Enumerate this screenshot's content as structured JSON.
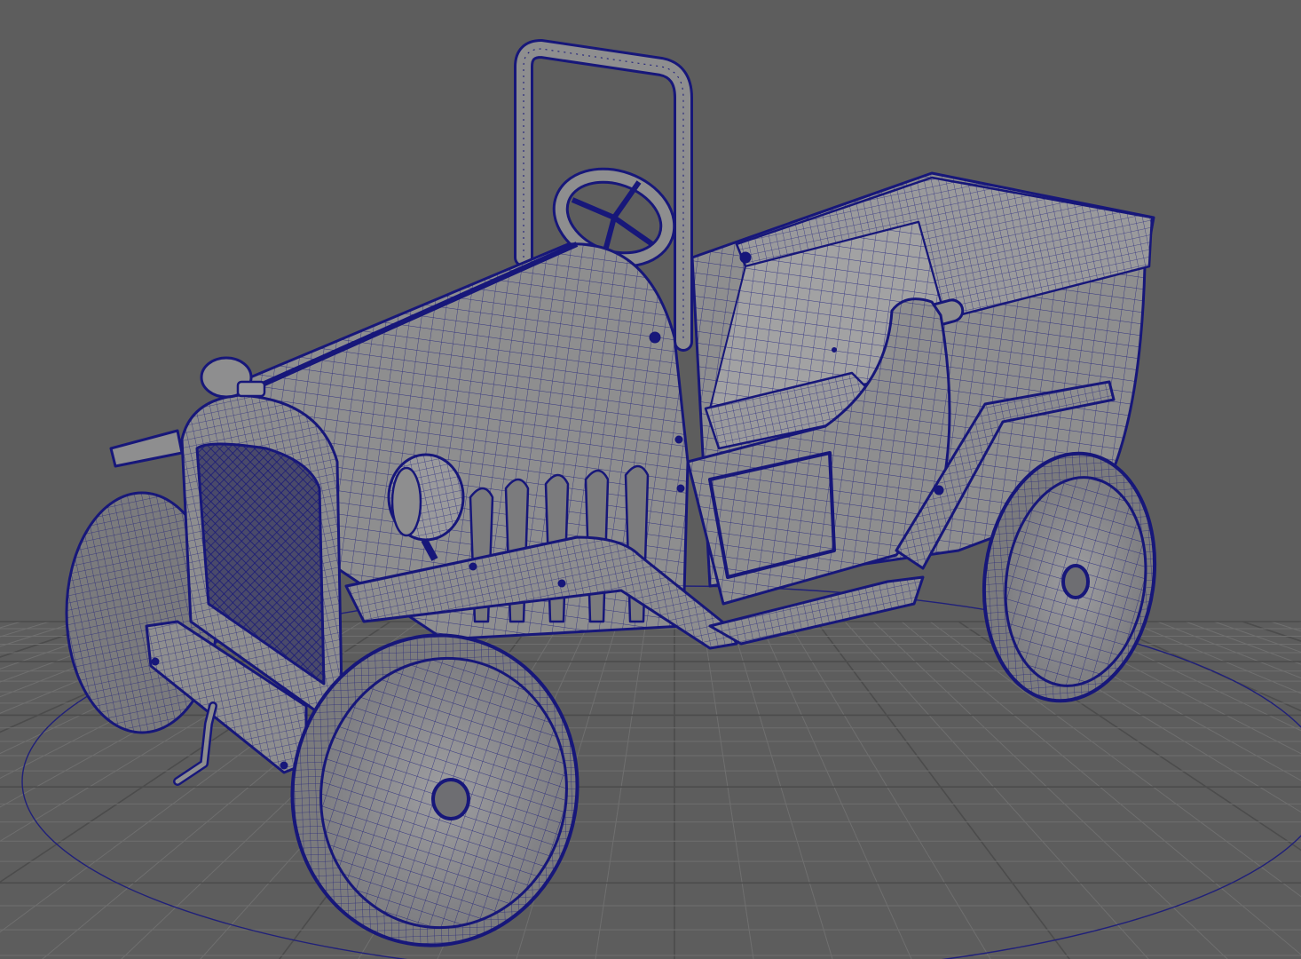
{
  "viewport": {
    "background": "#5d5d5d",
    "grid_color": "#6f6f6f",
    "grid_major_color": "#4c4c4c",
    "circle_color": "#20207a",
    "wire_color": "#17177a",
    "mesh_fill": "#8e8e8f",
    "mesh_fill_light": "#a2a2a3",
    "mesh_fill_dark": "#7b7b7d",
    "shading_mode": "wireframe-on-shaded",
    "selected_object": "pedal-car-model"
  }
}
